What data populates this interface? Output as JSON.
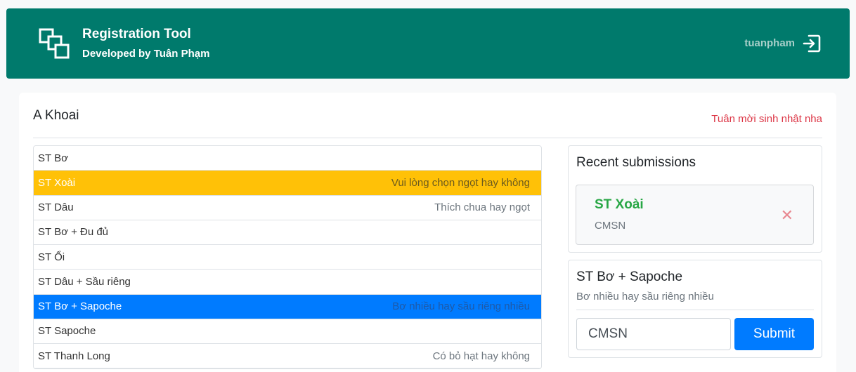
{
  "header": {
    "title": "Registration Tool",
    "subtitle": "Developed by Tuân Phạm",
    "username": "tuanpham",
    "logo_icon": "stacked-squares-icon",
    "logout_icon": "logout-icon",
    "bg_color": "#007a6c"
  },
  "card": {
    "title": "A Khoai",
    "note": "Tuân mời sinh nhật nha"
  },
  "list": {
    "items": [
      {
        "label": "ST Bơ",
        "hint": ""
      },
      {
        "label": "ST Xoài",
        "hint": "Vui lòng chọn ngọt hay không"
      },
      {
        "label": "ST Dâu",
        "hint": "Thích chua hay ngọt"
      },
      {
        "label": "ST Bơ + Đu đủ",
        "hint": ""
      },
      {
        "label": "ST Ổi",
        "hint": ""
      },
      {
        "label": "ST Dâu + Sầu riêng",
        "hint": ""
      },
      {
        "label": "ST Bơ + Sapoche",
        "hint": "Bơ nhiều hay sầu riêng nhiều"
      },
      {
        "label": "ST Sapoche",
        "hint": ""
      },
      {
        "label": "ST Thanh Long",
        "hint": "Có bỏ hạt hay không"
      }
    ],
    "warn_color": "#ffc107",
    "active_color": "#007bff"
  },
  "recent": {
    "title": "Recent submissions",
    "items": [
      {
        "name": "ST Xoài",
        "code": "CMSN",
        "remove": "✕"
      }
    ]
  },
  "form": {
    "title": "ST Bơ + Sapoche",
    "subtitle": "Bơ nhiều hay sầu riêng nhiều",
    "input_value": "CMSN",
    "submit_label": "Submit"
  }
}
